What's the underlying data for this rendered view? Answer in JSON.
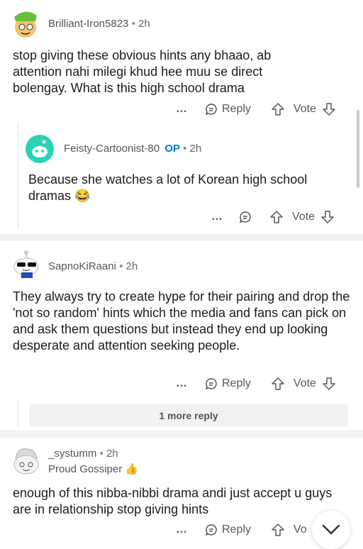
{
  "comments": [
    {
      "username": "Brilliant-Iron5823",
      "time": "2h",
      "text": "stop giving these obvious hints any bhaao, ab attention nahi milegi khud hee muu se direct bolengay. What is this high school drama",
      "reply_label": "Reply",
      "vote_label": "Vote"
    },
    {
      "username": "Feisty-Cartoonist-80",
      "badge": "OP",
      "time": "2h",
      "text": "Because she watches a lot of Korean high school dramas",
      "emoji": "😂",
      "vote_label": "Vote"
    },
    {
      "username": "SapnoKiRaani",
      "time": "2h",
      "text": "They always try to create hype for their pairing and drop the 'not so random' hints which the media and fans can pick on and ask them questions but instead they end up looking desperate and attention seeking people.",
      "reply_label": "Reply",
      "vote_label": "Vote",
      "more_replies": "1 more reply"
    },
    {
      "username": "_systumm",
      "time": "2h",
      "flair": "Proud Gossiper",
      "flair_emoji": "👍",
      "text": "enough of this nibba-nibbi drama andi just accept u guys are in relationship stop giving hints",
      "reply_label": "Reply",
      "vote_label": "Vo"
    }
  ],
  "separator": "•",
  "more_icon": "…",
  "colors": {
    "op_badge": "#0079d3",
    "avatar_teal": "#2ad3b5",
    "separator": "#f1f2f3"
  }
}
